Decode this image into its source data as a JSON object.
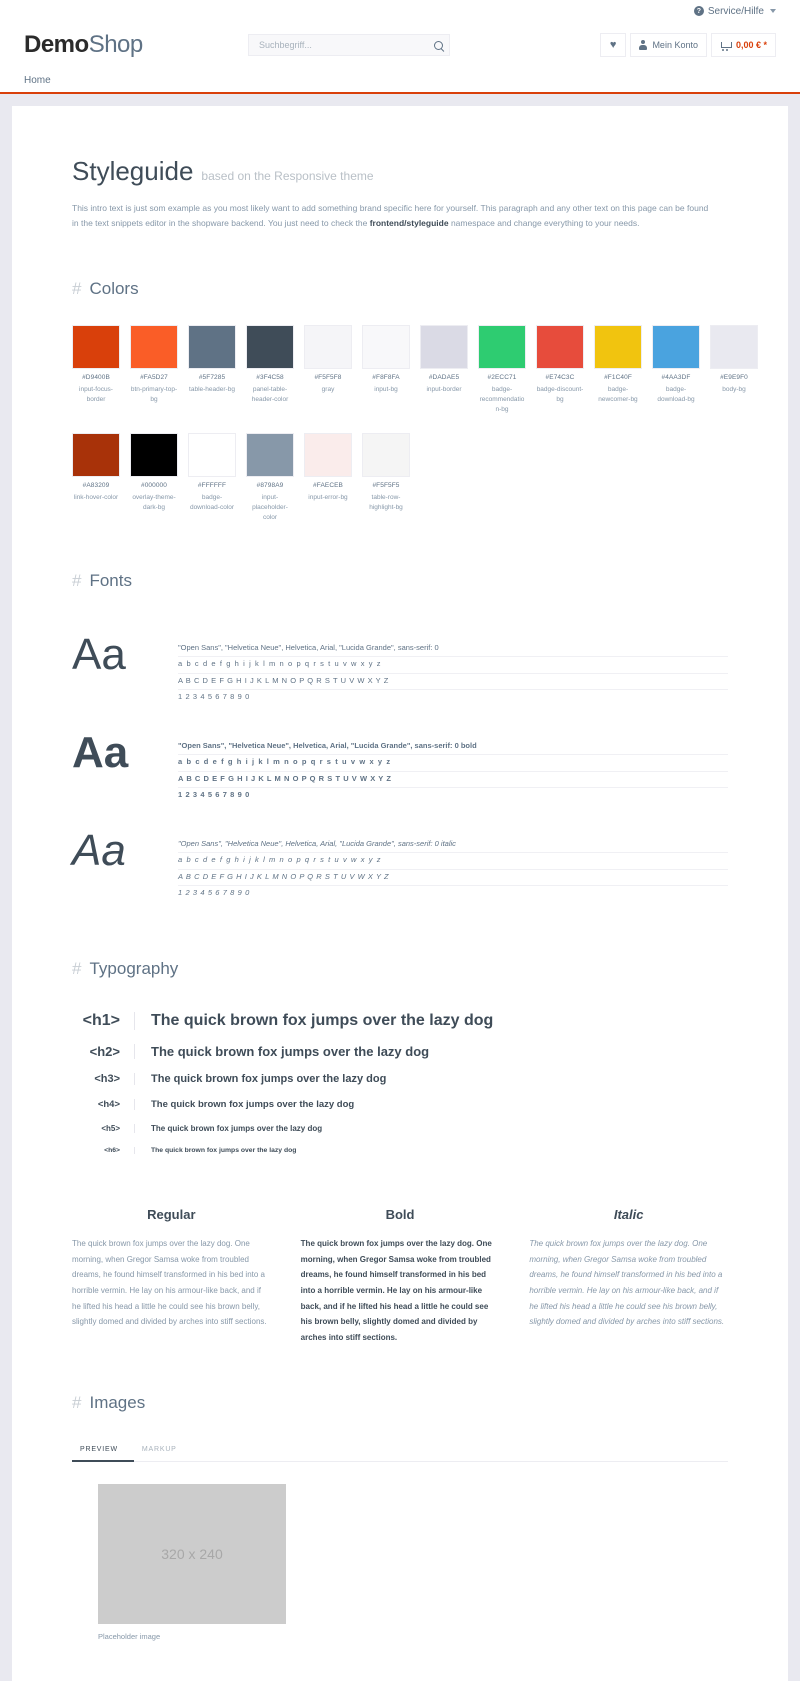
{
  "topbar": {
    "service_label": "Service/Hilfe",
    "help_icon": "question-circle-icon",
    "caret_icon": "chevron-down-icon"
  },
  "header": {
    "logo_bold": "Demo",
    "logo_light": "Shop",
    "search": {
      "placeholder": "Suchbegriff...",
      "value": "",
      "icon": "search-icon"
    },
    "wishlist_icon": "heart-icon",
    "account_label": "Mein Konto",
    "account_icon": "user-icon",
    "cart_icon": "shopping-cart-icon",
    "cart_total": "0,00 € *"
  },
  "nav": {
    "items": [
      {
        "label": "Home"
      }
    ]
  },
  "styleguide": {
    "title": "Styleguide",
    "subtitle": "based on the Responsive theme",
    "intro_part1": "This intro text is just som example as you most likely want to add something brand specific here for yourself. This paragraph and any other text on this page can be found in the text snippets editor in the shopware backend. You just need to check the ",
    "intro_bold": "frontend/styleguide",
    "intro_part2": " namespace and change everything to your needs."
  },
  "sections": {
    "colors": "Colors",
    "fonts": "Fonts",
    "typography": "Typography",
    "images": "Images"
  },
  "colors": {
    "row1": [
      {
        "hex": "#D9400B",
        "name": "input-focus-border"
      },
      {
        "hex": "#FA5D27",
        "name": "btn-primary-top-bg"
      },
      {
        "hex": "#5F7285",
        "name": "table-header-bg"
      },
      {
        "hex": "#3F4C58",
        "name": "panel-table-header-color"
      },
      {
        "hex": "#F5F5F8",
        "name": "gray"
      },
      {
        "hex": "#F8F8FA",
        "name": "input-bg"
      },
      {
        "hex": "#DADAE5",
        "name": "input-border"
      },
      {
        "hex": "#2ECC71",
        "name": "badge-recommendation-bg"
      },
      {
        "hex": "#E74C3C",
        "name": "badge-discount-bg"
      },
      {
        "hex": "#F1C40F",
        "name": "badge-newcomer-bg"
      },
      {
        "hex": "#4AA3DF",
        "name": "badge-download-bg"
      },
      {
        "hex": "#E9E9F0",
        "name": "body-bg"
      }
    ],
    "row2": [
      {
        "hex": "#A83209",
        "name": "link-hover-color"
      },
      {
        "hex": "#000000",
        "name": "overlay-theme-dark-bg"
      },
      {
        "hex": "#FFFFFF",
        "name": "badge-download-color"
      },
      {
        "hex": "#8798A9",
        "name": "input-placeholder-color"
      },
      {
        "hex": "#FAECEB",
        "name": "input-error-bg"
      },
      {
        "hex": "#F5F5F5",
        "name": "table-row-highlight-bg"
      }
    ]
  },
  "fonts": [
    {
      "sample": "Aa",
      "spec": "\"Open Sans\", \"Helvetica Neue\", Helvetica, Arial, \"Lucida Grande\", sans-serif: 0",
      "lower": "a b c d e f g h i j k l m n o p q r s t u v w x y z",
      "upper": "A B C D E F G H I J K L M N O P Q R S T U V W X Y Z",
      "nums": "1 2 3 4 5 6 7 8 9 0"
    },
    {
      "sample": "Aa",
      "spec": "\"Open Sans\", \"Helvetica Neue\", Helvetica, Arial, \"Lucida Grande\", sans-serif: 0 bold",
      "lower": "a b c d e f g h i j k l m n o p q r s t u v w x y z",
      "upper": "A B C D E F G H I J K L M N O P Q R S T U V W X Y Z",
      "nums": "1 2 3 4 5 6 7 8 9 0"
    },
    {
      "sample": "Aa",
      "spec": "\"Open Sans\", \"Helvetica Neue\", Helvetica, Arial, \"Lucida Grande\", sans-serif: 0 italic",
      "lower": "a b c d e f g h i j k l m n o p q r s t u v w x y z",
      "upper": "A B C D E F G H I J K L M N O P Q R S T U V W X Y Z",
      "nums": "1 2 3 4 5 6 7 8 9 0"
    }
  ],
  "typography": {
    "rows": [
      {
        "tag": "<h1>",
        "text": "The quick brown fox jumps over the lazy dog"
      },
      {
        "tag": "<h2>",
        "text": "The quick brown fox jumps over the lazy dog"
      },
      {
        "tag": "<h3>",
        "text": "The quick brown fox jumps over the lazy dog"
      },
      {
        "tag": "<h4>",
        "text": "The quick brown fox jumps over the lazy dog"
      },
      {
        "tag": "<h5>",
        "text": "The quick brown fox jumps over the lazy dog"
      },
      {
        "tag": "<h6>",
        "text": "The quick brown fox jumps over the lazy dog"
      }
    ],
    "columns": [
      {
        "heading": "Regular",
        "body": "The quick brown fox jumps over the lazy dog. One morning, when Gregor Samsa woke from troubled dreams, he found himself transformed in his bed into a horrible vermin. He lay on his armour-like back, and if he lifted his head a little he could see his brown belly, slightly domed and divided by arches into stiff sections."
      },
      {
        "heading": "Bold",
        "body": "The quick brown fox jumps over the lazy dog. One morning, when Gregor Samsa woke from troubled dreams, he found himself transformed in his bed into a horrible vermin. He lay on his armour-like back, and if he lifted his head a little he could see his brown belly, slightly domed and divided by arches into stiff sections."
      },
      {
        "heading": "Italic",
        "body": "The quick brown fox jumps over the lazy dog. One morning, when Gregor Samsa woke from troubled dreams, he found himself transformed in his bed into a horrible vermin. He lay on his armour-like back, and if he lifted his head a little he could see his brown belly, slightly domed and divided by arches into stiff sections."
      }
    ]
  },
  "images": {
    "tabs": [
      {
        "label": "PREVIEW",
        "active": true
      },
      {
        "label": "MARKUP",
        "active": false
      }
    ],
    "placeholder_text": "320 x 240",
    "caption": "Placeholder image"
  }
}
